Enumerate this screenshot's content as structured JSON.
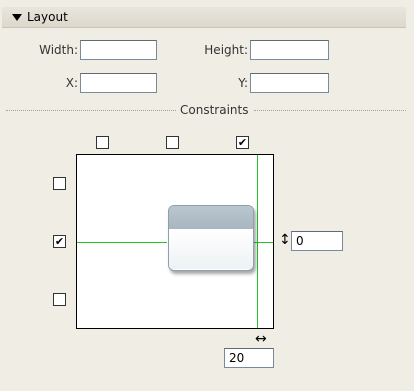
{
  "panel": {
    "title": "Layout"
  },
  "fields": {
    "width_label": "Width:",
    "width_value": "",
    "height_label": "Height:",
    "height_value": "",
    "x_label": "X:",
    "x_value": "",
    "y_label": "Y:",
    "y_value": ""
  },
  "constraints": {
    "label": "Constraints",
    "top_left": false,
    "top_center": false,
    "top_right": true,
    "left_top": false,
    "left_middle": true,
    "left_bottom": false,
    "right_offset": "0",
    "bottom_offset": "20"
  },
  "icons": {
    "disclosure": "triangle-down-icon",
    "vertical_arrow": "up-down-arrow-icon",
    "horizontal_arrow": "left-right-arrow-icon"
  },
  "colors": {
    "guide": "#27c227",
    "panel_bg": "#f0ede4"
  }
}
